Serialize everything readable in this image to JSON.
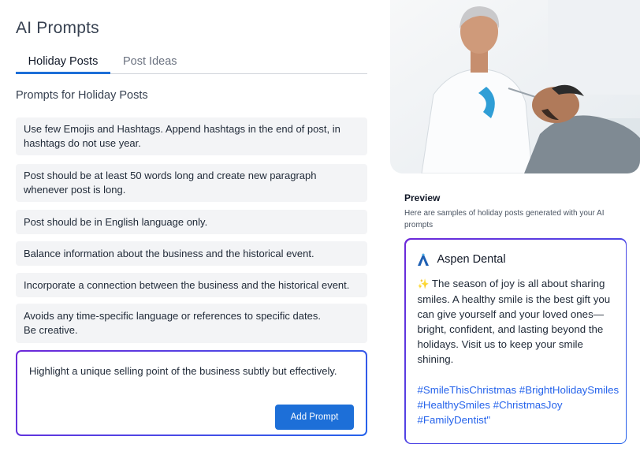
{
  "page": {
    "title": "AI Prompts"
  },
  "tabs": [
    {
      "label": "Holiday Posts",
      "active": true
    },
    {
      "label": "Post Ideas",
      "active": false
    }
  ],
  "section": {
    "title": "Prompts for Holiday Posts"
  },
  "prompts": [
    "Use few Emojis and Hashtags. Append hashtags in the end of post, in hashtags do not use year.",
    "Post should be at least 50 words long and create new paragraph whenever post is long.",
    "Post should be in English language only.",
    "Balance information about the business and the historical event.",
    "Incorporate a connection between the business and the historical event.",
    "Avoids any time-specific language or references to specific dates.\nBe creative."
  ],
  "composer": {
    "value": "Highlight a unique selling point of the business subtly but effectively.",
    "button_label": "Add Prompt"
  },
  "preview": {
    "title": "Preview",
    "description": "Here are samples of holiday posts generated with your AI prompts",
    "brand_name": "Aspen Dental",
    "body": "The season of joy is all about sharing smiles. A healthy smile is the best gift you can give yourself and your loved ones—bright, confident, and lasting beyond the holidays. Visit us to keep your smile shining.",
    "hashtags": "#SmileThisChristmas #BrightHolidaySmiles #HealthySmiles #ChristmasJoy #FamilyDentist\""
  },
  "colors": {
    "accent": "#1d6fd8",
    "gradient_start": "#6d28d9",
    "gradient_end": "#2563eb",
    "hashtag": "#2563eb"
  }
}
